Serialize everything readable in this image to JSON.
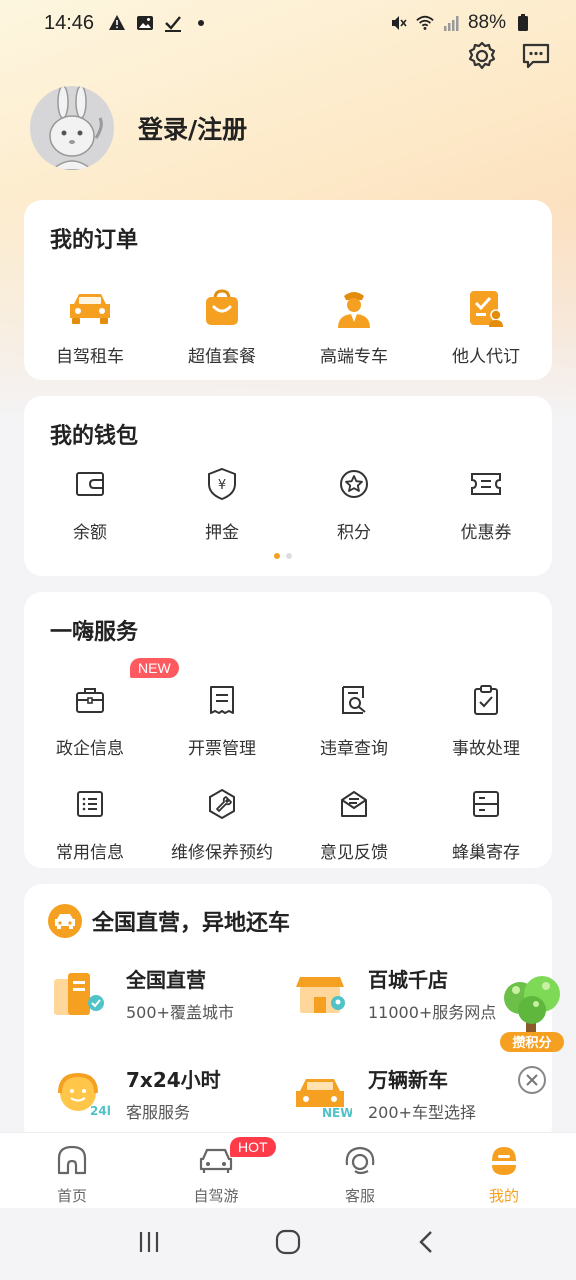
{
  "status_bar": {
    "time": "14:46",
    "battery": "88%"
  },
  "profile": {
    "login_label": "登录/注册"
  },
  "orders": {
    "title": "我的订单",
    "items": [
      {
        "label": "自驾租车",
        "icon": "car-icon"
      },
      {
        "label": "超值套餐",
        "icon": "shopping-bag-icon"
      },
      {
        "label": "高端专车",
        "icon": "chauffeur-icon"
      },
      {
        "label": "他人代订",
        "icon": "clipboard-user-icon"
      }
    ]
  },
  "wallet": {
    "title": "我的钱包",
    "items": [
      {
        "label": "余额",
        "icon": "wallet-icon"
      },
      {
        "label": "押金",
        "icon": "deposit-shield-icon"
      },
      {
        "label": "积分",
        "icon": "points-star-icon"
      },
      {
        "label": "优惠券",
        "icon": "coupon-icon"
      }
    ]
  },
  "services": {
    "title": "一嗨服务",
    "new_badge": "NEW",
    "items": [
      {
        "label": "政企信息",
        "icon": "briefcase-icon"
      },
      {
        "label": "开票管理",
        "icon": "invoice-icon"
      },
      {
        "label": "违章查询",
        "icon": "violation-search-icon"
      },
      {
        "label": "事故处理",
        "icon": "clipboard-check-icon"
      },
      {
        "label": "常用信息",
        "icon": "list-icon"
      },
      {
        "label": "维修保养预约",
        "icon": "wrench-icon"
      },
      {
        "label": "意见反馈",
        "icon": "feedback-mail-icon"
      },
      {
        "label": "蜂巢寄存",
        "icon": "locker-icon"
      }
    ]
  },
  "features": {
    "title": "全国直营，异地还车",
    "items": [
      {
        "title": "全国直营",
        "subtitle": "500+覆盖城市"
      },
      {
        "title": "百城千店",
        "subtitle": "11000+服务网点"
      },
      {
        "title": "7x24小时",
        "subtitle": "客服服务"
      },
      {
        "title": "万辆新车",
        "subtitle": "200+车型选择"
      }
    ],
    "floating_label": "攒积分"
  },
  "bottom_nav": {
    "hot_badge": "HOT",
    "items": [
      {
        "label": "首页",
        "icon": "home-icon"
      },
      {
        "label": "自驾游",
        "icon": "car-outline-icon"
      },
      {
        "label": "客服",
        "icon": "headset-icon"
      },
      {
        "label": "我的",
        "icon": "profile-icon"
      }
    ],
    "active": "我的"
  },
  "colors": {
    "accent": "#f5a021",
    "badge": "#ff5a5f"
  }
}
